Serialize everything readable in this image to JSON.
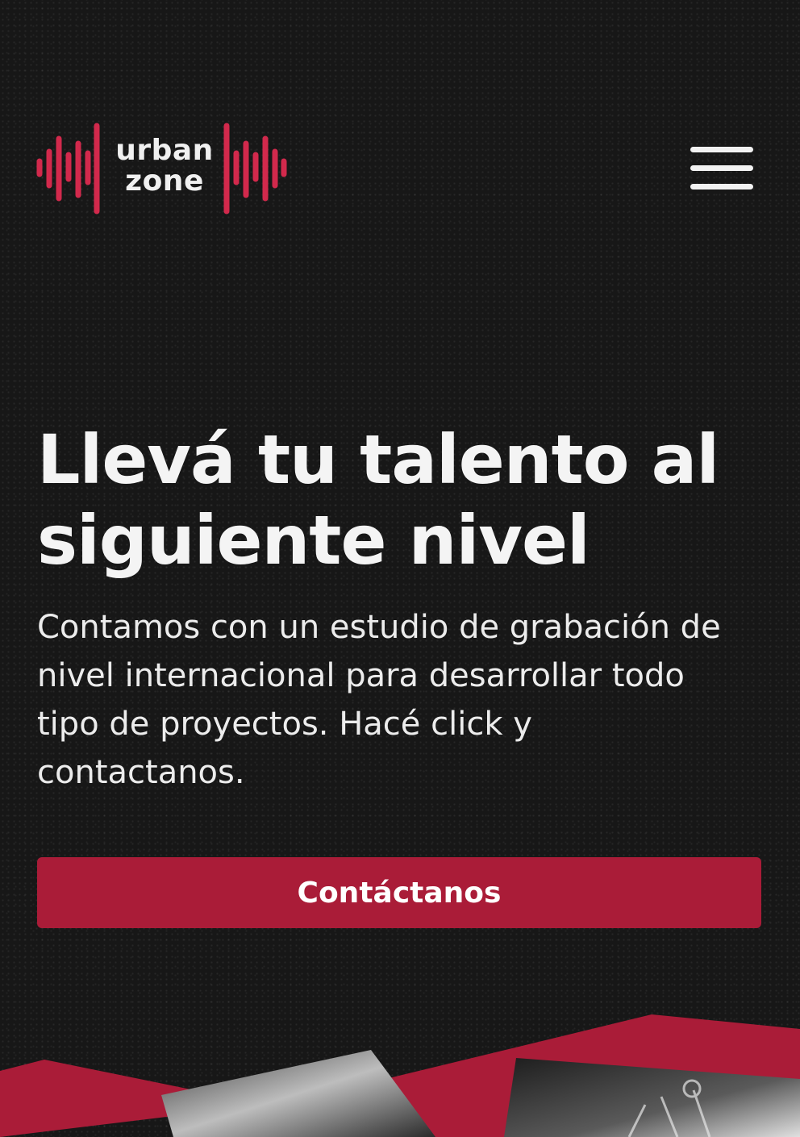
{
  "brand": {
    "logo_line1": "urban",
    "logo_line2": "zone",
    "accent_color": "#aa1c38",
    "logo_wave_color": "#d2294c"
  },
  "header": {
    "menu_icon": "hamburger-menu-icon"
  },
  "hero": {
    "title": "Llevá tu talento al siguiente nivel",
    "description": "Contamos con un estudio de grabación de nivel internacional para desarrollar todo tipo de proyectos. Hacé click y contactanos.",
    "cta_label": "Contáctanos"
  }
}
